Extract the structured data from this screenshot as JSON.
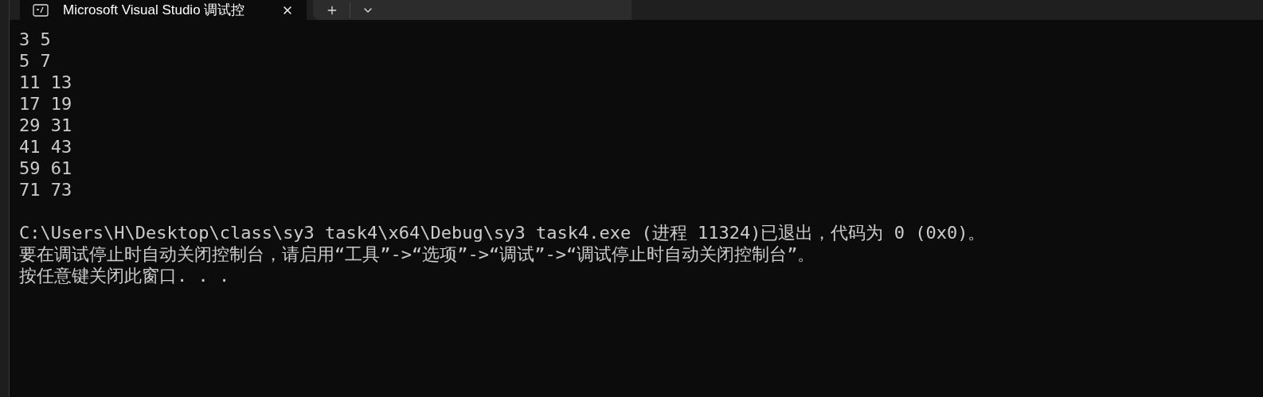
{
  "tab": {
    "title": "Microsoft Visual Studio 调试控",
    "selected": true
  },
  "output": {
    "results": [
      "3 5",
      "5 7",
      "11 13",
      "17 19",
      "29 31",
      "41 43",
      "59 61",
      "71 73"
    ],
    "messages": [
      "C:\\Users\\H\\Desktop\\class\\sy3 task4\\x64\\Debug\\sy3 task4.exe (进程 11324)已退出，代码为 0 (0x0)。",
      "要在调试停止时自动关闭控制台，请启用“工具”->“选项”->“调试”->“调试停止时自动关闭控制台”。",
      "按任意键关闭此窗口. . ."
    ]
  }
}
